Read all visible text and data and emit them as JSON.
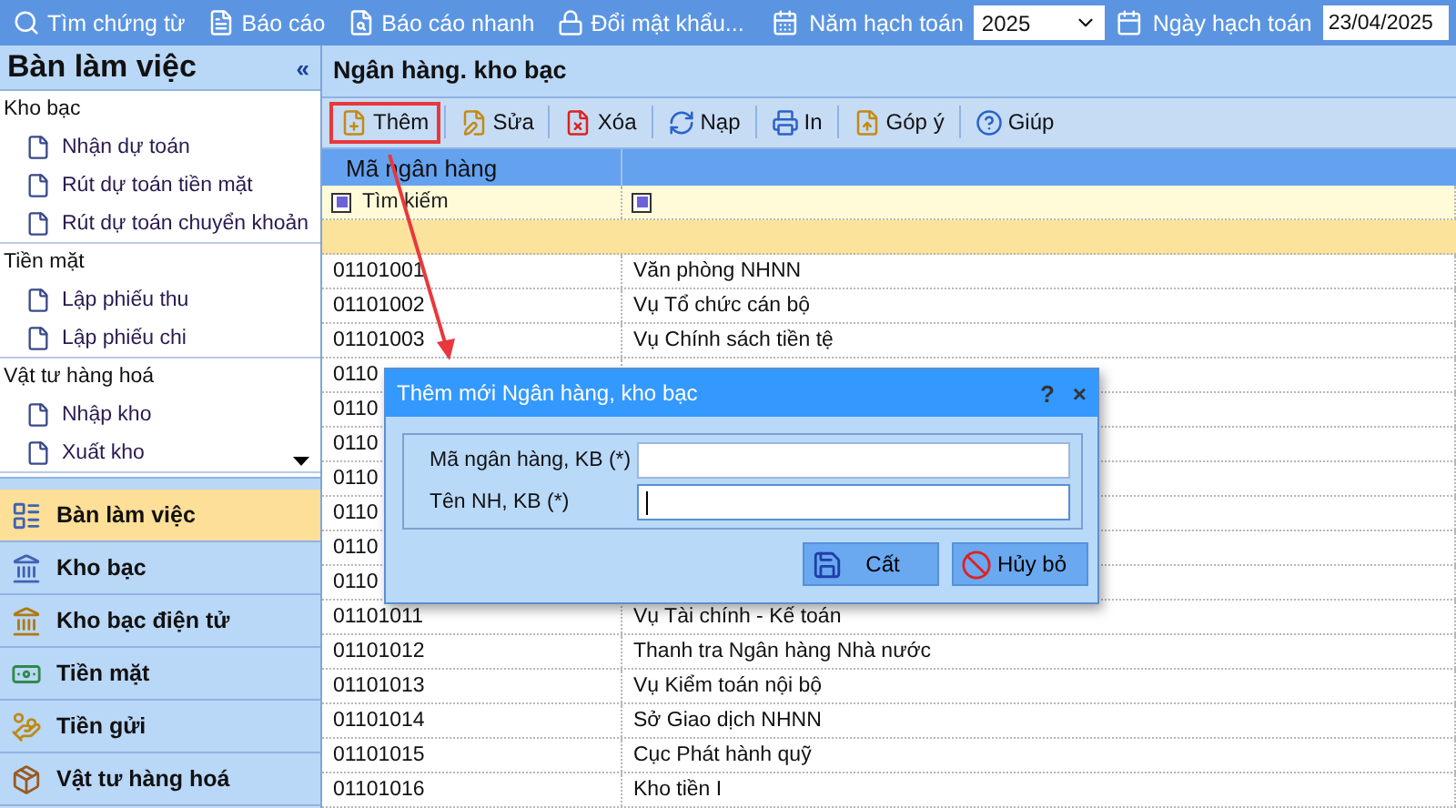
{
  "top_toolbar": {
    "items": [
      {
        "kind": "search",
        "label": "Tìm chứng từ"
      },
      {
        "kind": "report",
        "label": "Báo cáo"
      },
      {
        "kind": "quick",
        "label": "Báo cáo nhanh"
      },
      {
        "kind": "lock",
        "label": "Đổi mật khẩu..."
      }
    ],
    "year_label": "Năm hạch toán",
    "year_select": {
      "value": "2025"
    },
    "date_label": "Ngày hạch toán",
    "date_field": {
      "value": "23/04/2025"
    }
  },
  "sidebar": {
    "title": "Bàn làm việc",
    "collapse": "«",
    "groups": [
      {
        "label": "Kho bạc",
        "items": [
          "Nhận dự toán",
          "Rút dự toán tiền mặt",
          "Rút dự toán chuyển khoản"
        ]
      },
      {
        "label": "Tiền mặt",
        "items": [
          "Lập phiếu thu",
          "Lập phiếu chi"
        ]
      },
      {
        "label": "Vật tư hàng hoá",
        "items": [
          "Nhập kho",
          "Xuất kho"
        ]
      }
    ],
    "nav": [
      {
        "kind": "desk",
        "label": "Bàn làm việc",
        "selected": true
      },
      {
        "kind": "bank",
        "label": "Kho bạc",
        "selected": false
      },
      {
        "kind": "ebank",
        "label": "Kho bạc điện tử",
        "selected": false
      },
      {
        "kind": "cash",
        "label": "Tiền mặt",
        "selected": false
      },
      {
        "kind": "deposit",
        "label": "Tiền gửi",
        "selected": false
      },
      {
        "kind": "goods",
        "label": "Vật tư hàng hoá",
        "selected": false
      }
    ]
  },
  "main": {
    "title": "Ngân hàng. kho bạc",
    "toolbar": [
      {
        "kind": "add",
        "label": "Thêm",
        "highlighted": true
      },
      {
        "kind": "edit",
        "label": "Sửa",
        "highlighted": false
      },
      {
        "kind": "delete",
        "label": "Xóa",
        "highlighted": false
      },
      {
        "kind": "reload",
        "label": "Nạp",
        "highlighted": false
      },
      {
        "kind": "print",
        "label": "In",
        "highlighted": false
      },
      {
        "kind": "feedback",
        "label": "Góp ý",
        "highlighted": false
      },
      {
        "kind": "help",
        "label": "Giúp",
        "highlighted": false
      }
    ],
    "table": {
      "columns": [
        "Mã ngân hàng"
      ],
      "filter": {
        "placeholder": "Tìm kiếm"
      },
      "rows": [
        {
          "code": "01101001",
          "name": "Văn phòng NHNN"
        },
        {
          "code": "01101002",
          "name": "Vụ Tổ chức cán bộ"
        },
        {
          "code": "01101003",
          "name": "Vụ Chính sách tiền tệ"
        },
        {
          "code": "0110"
        },
        {
          "code": "0110"
        },
        {
          "code": "0110"
        },
        {
          "code": "0110"
        },
        {
          "code": "0110"
        },
        {
          "code": "0110"
        },
        {
          "code": "0110"
        },
        {
          "code": "01101011",
          "name": "Vụ Tài chính - Kế toán"
        },
        {
          "code": "01101012",
          "name": "Thanh tra Ngân hàng Nhà nước"
        },
        {
          "code": "01101013",
          "name": "Vụ Kiểm toán nội bộ"
        },
        {
          "code": "01101014",
          "name": "Sở Giao dịch NHNN"
        },
        {
          "code": "01101015",
          "name": "Cục Phát hành  quỹ"
        },
        {
          "code": "01101016",
          "name": "Kho tiền I"
        }
      ]
    }
  },
  "dialog": {
    "title": "Thêm mới Ngân hàng, kho bạc",
    "help": "?",
    "close": "×",
    "fields": [
      {
        "label": "Mã ngân hàng, KB (*)",
        "focused": false
      },
      {
        "label": "Tên NH, KB (*)",
        "focused": true
      }
    ],
    "buttons": [
      {
        "kind": "save",
        "label": "Cất"
      },
      {
        "kind": "cancel",
        "label": "Hủy bỏ"
      }
    ]
  }
}
